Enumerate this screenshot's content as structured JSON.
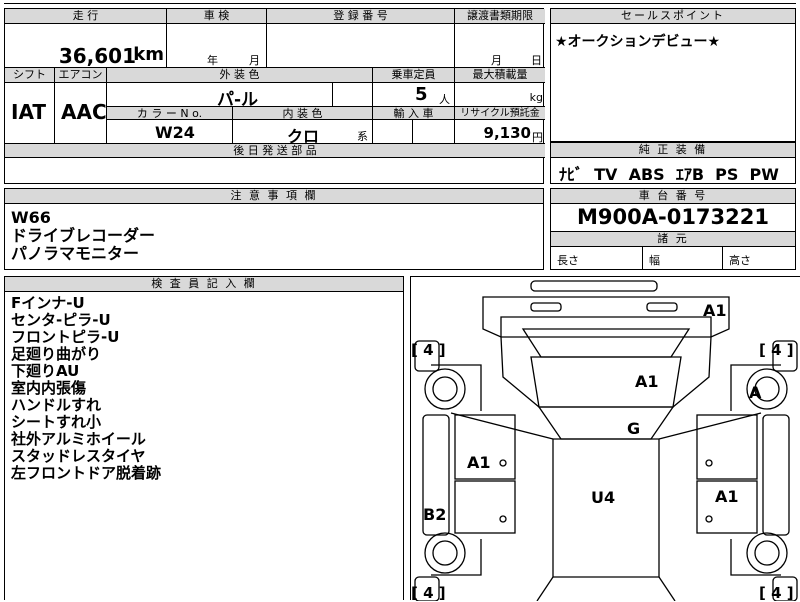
{
  "top": {
    "mileage_label": "走 行",
    "mileage_value": "36,601",
    "mileage_unit": "km",
    "inspection_label": "車 検",
    "inspection_year": "年",
    "inspection_month": "月",
    "registration_label": "登 録 番 号",
    "transfer_label": "譲渡書類期限",
    "transfer_month": "月",
    "transfer_day": "日"
  },
  "specs": {
    "shift_label": "シフト",
    "shift_value": "IAT",
    "ac_label": "エアコン",
    "ac_value": "AAC",
    "exterior_label": "外 装 色",
    "exterior_value": "パ-ル",
    "capacity_label": "乗車定員",
    "capacity_value": "5",
    "capacity_unit": "人",
    "max_load_label": "最大積載量",
    "max_load_unit": "kg",
    "color_no_label": "カ ラ ー N o.",
    "color_no_value": "W24",
    "interior_label": "内 装 色",
    "interior_value": "クロ",
    "interior_suffix": "系",
    "import_label": "輸 入 車",
    "recycle_label": "リサイクル預託金",
    "recycle_value": "9,130",
    "recycle_unit": "円",
    "later_parts_label": "後 日 発 送 部 品"
  },
  "sales": {
    "header": "セールスポイント",
    "text": "★オークションデビュー★",
    "equip_header": "純 正 装 備",
    "equip_value": "ﾅﾋﾞ  TV  ABS  ｴｱB  PS  PW"
  },
  "notes": {
    "header": "注 意 事 項 欄",
    "lines": [
      "W66",
      "ドライブレコーダー",
      "パノラマモニター"
    ]
  },
  "chassis": {
    "header": "車 台 番 号",
    "value": "M900A-0173221",
    "dims_header": "諸 元",
    "length_label": "長さ",
    "width_label": "幅",
    "height_label": "高さ"
  },
  "inspector": {
    "header": "検 査 員 記 入 欄",
    "lines": [
      "Fインナ-U",
      "センタ-ピラ-U",
      "フロントピラ-U",
      "足廻り曲がり",
      "下廻りAU",
      "室内内張傷",
      "ハンドルすれ",
      "シートすれ小",
      "社外アルミホイール",
      "スタッドレスタイヤ",
      "左フロントドア脱着跡"
    ]
  },
  "diagram": {
    "marks": {
      "a1_top": "A1",
      "a1_roof": "A1",
      "a_right_wheel": "A",
      "g": "G",
      "a1_left": "A1",
      "u4": "U4",
      "a1_right": "A1",
      "b2": "B2"
    },
    "tire_left_top": "4",
    "tire_right_top": "4",
    "tire_left_bottom": "4",
    "tire_right_bottom": "4"
  }
}
